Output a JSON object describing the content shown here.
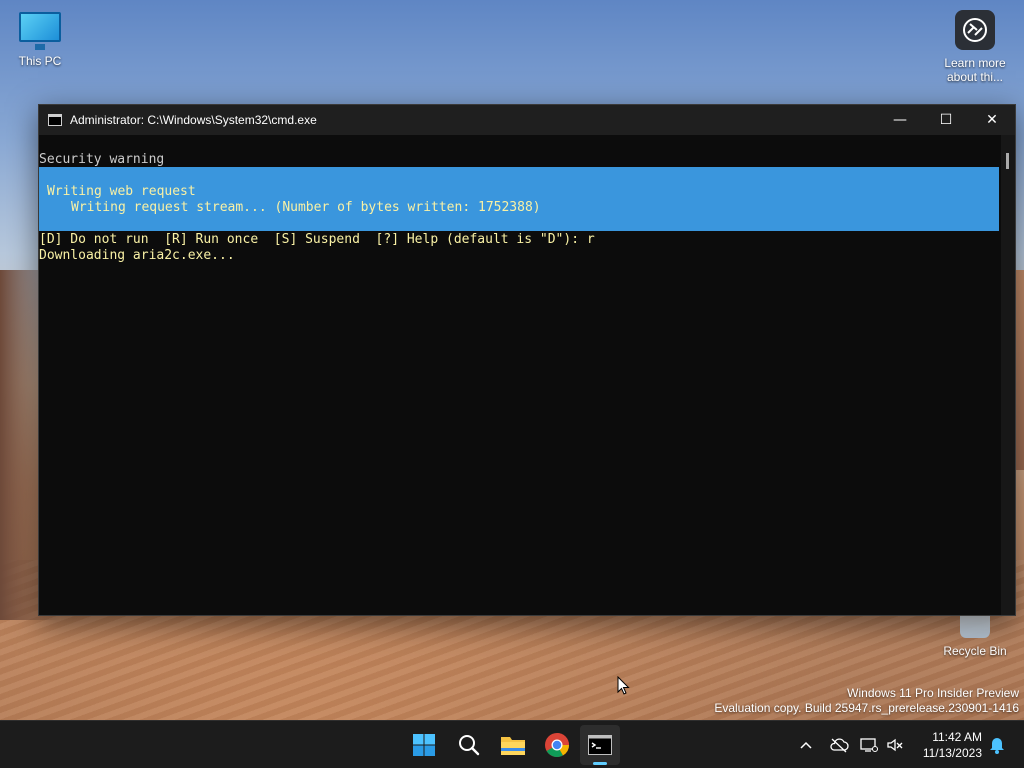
{
  "desktop": {
    "icons": [
      {
        "label": "This PC"
      },
      {
        "label": "Learn more about thi..."
      },
      {
        "label": "Recycle Bin"
      }
    ],
    "watermark": {
      "line1": "Windows 11 Pro Insider Preview",
      "line2": "Evaluation copy. Build 25947.rs_prerelease.230901-1416"
    }
  },
  "window": {
    "title": "Administrator: C:\\Windows\\System32\\cmd.exe",
    "controls": {
      "minimize": "—",
      "maximize": "☐",
      "close": "✕"
    }
  },
  "console": {
    "lines": {
      "warning": "Security warning",
      "progress_title": "Writing web request",
      "progress_detail": "Writing request stream... (Number of bytes written: 1752388)",
      "prompt": "[D] Do not run  [R] Run once  [S] Suspend  [?] Help (default is \"D\"): r",
      "download": "Downloading aria2c.exe..."
    }
  },
  "taskbar": {
    "clock": {
      "time": "11:42 AM",
      "date": "11/13/2023"
    }
  },
  "colors": {
    "progress_bg": "#3a96dd",
    "console_yellow": "#f9f1a5",
    "console_bg": "#0c0c0c",
    "taskbar_bg": "#1c1c1c",
    "active_indicator": "#60cdff"
  }
}
